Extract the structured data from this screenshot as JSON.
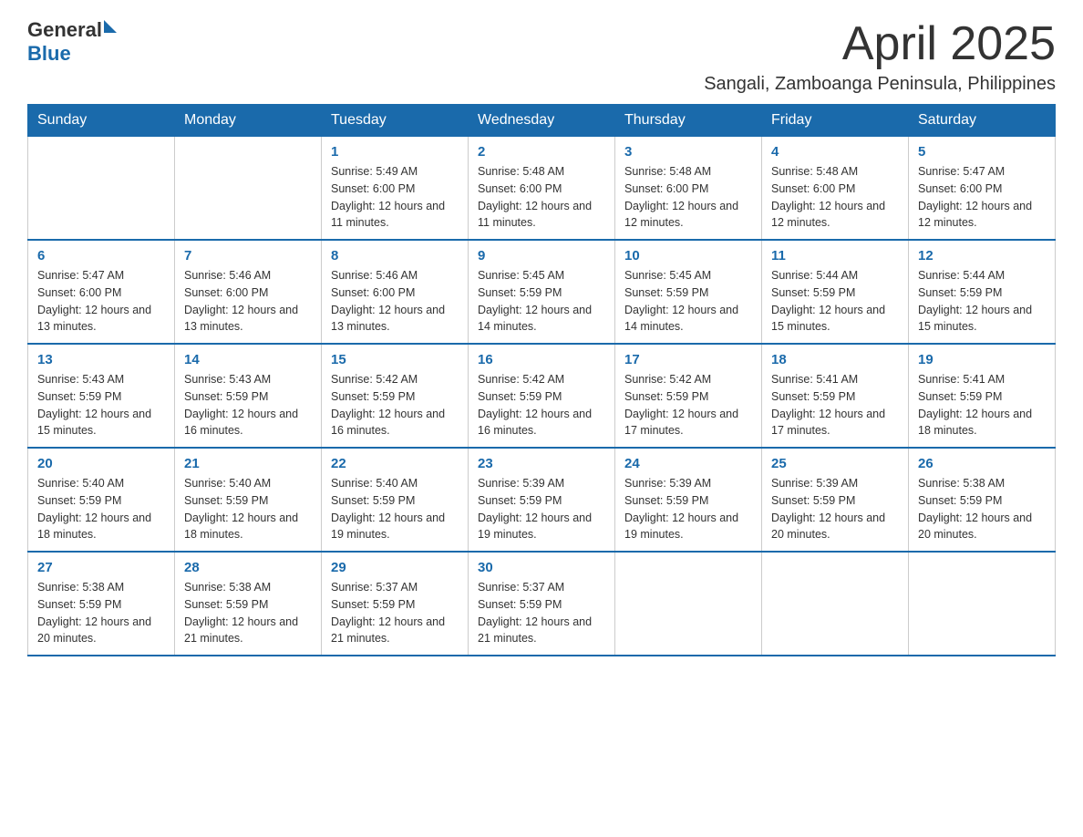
{
  "logo": {
    "general": "General",
    "blue": "Blue"
  },
  "title": {
    "month_year": "April 2025",
    "location": "Sangali, Zamboanga Peninsula, Philippines"
  },
  "weekdays": [
    "Sunday",
    "Monday",
    "Tuesday",
    "Wednesday",
    "Thursday",
    "Friday",
    "Saturday"
  ],
  "weeks": [
    [
      {
        "day": "",
        "sunrise": "",
        "sunset": "",
        "daylight": ""
      },
      {
        "day": "",
        "sunrise": "",
        "sunset": "",
        "daylight": ""
      },
      {
        "day": "1",
        "sunrise": "Sunrise: 5:49 AM",
        "sunset": "Sunset: 6:00 PM",
        "daylight": "Daylight: 12 hours and 11 minutes."
      },
      {
        "day": "2",
        "sunrise": "Sunrise: 5:48 AM",
        "sunset": "Sunset: 6:00 PM",
        "daylight": "Daylight: 12 hours and 11 minutes."
      },
      {
        "day": "3",
        "sunrise": "Sunrise: 5:48 AM",
        "sunset": "Sunset: 6:00 PM",
        "daylight": "Daylight: 12 hours and 12 minutes."
      },
      {
        "day": "4",
        "sunrise": "Sunrise: 5:48 AM",
        "sunset": "Sunset: 6:00 PM",
        "daylight": "Daylight: 12 hours and 12 minutes."
      },
      {
        "day": "5",
        "sunrise": "Sunrise: 5:47 AM",
        "sunset": "Sunset: 6:00 PM",
        "daylight": "Daylight: 12 hours and 12 minutes."
      }
    ],
    [
      {
        "day": "6",
        "sunrise": "Sunrise: 5:47 AM",
        "sunset": "Sunset: 6:00 PM",
        "daylight": "Daylight: 12 hours and 13 minutes."
      },
      {
        "day": "7",
        "sunrise": "Sunrise: 5:46 AM",
        "sunset": "Sunset: 6:00 PM",
        "daylight": "Daylight: 12 hours and 13 minutes."
      },
      {
        "day": "8",
        "sunrise": "Sunrise: 5:46 AM",
        "sunset": "Sunset: 6:00 PM",
        "daylight": "Daylight: 12 hours and 13 minutes."
      },
      {
        "day": "9",
        "sunrise": "Sunrise: 5:45 AM",
        "sunset": "Sunset: 5:59 PM",
        "daylight": "Daylight: 12 hours and 14 minutes."
      },
      {
        "day": "10",
        "sunrise": "Sunrise: 5:45 AM",
        "sunset": "Sunset: 5:59 PM",
        "daylight": "Daylight: 12 hours and 14 minutes."
      },
      {
        "day": "11",
        "sunrise": "Sunrise: 5:44 AM",
        "sunset": "Sunset: 5:59 PM",
        "daylight": "Daylight: 12 hours and 15 minutes."
      },
      {
        "day": "12",
        "sunrise": "Sunrise: 5:44 AM",
        "sunset": "Sunset: 5:59 PM",
        "daylight": "Daylight: 12 hours and 15 minutes."
      }
    ],
    [
      {
        "day": "13",
        "sunrise": "Sunrise: 5:43 AM",
        "sunset": "Sunset: 5:59 PM",
        "daylight": "Daylight: 12 hours and 15 minutes."
      },
      {
        "day": "14",
        "sunrise": "Sunrise: 5:43 AM",
        "sunset": "Sunset: 5:59 PM",
        "daylight": "Daylight: 12 hours and 16 minutes."
      },
      {
        "day": "15",
        "sunrise": "Sunrise: 5:42 AM",
        "sunset": "Sunset: 5:59 PM",
        "daylight": "Daylight: 12 hours and 16 minutes."
      },
      {
        "day": "16",
        "sunrise": "Sunrise: 5:42 AM",
        "sunset": "Sunset: 5:59 PM",
        "daylight": "Daylight: 12 hours and 16 minutes."
      },
      {
        "day": "17",
        "sunrise": "Sunrise: 5:42 AM",
        "sunset": "Sunset: 5:59 PM",
        "daylight": "Daylight: 12 hours and 17 minutes."
      },
      {
        "day": "18",
        "sunrise": "Sunrise: 5:41 AM",
        "sunset": "Sunset: 5:59 PM",
        "daylight": "Daylight: 12 hours and 17 minutes."
      },
      {
        "day": "19",
        "sunrise": "Sunrise: 5:41 AM",
        "sunset": "Sunset: 5:59 PM",
        "daylight": "Daylight: 12 hours and 18 minutes."
      }
    ],
    [
      {
        "day": "20",
        "sunrise": "Sunrise: 5:40 AM",
        "sunset": "Sunset: 5:59 PM",
        "daylight": "Daylight: 12 hours and 18 minutes."
      },
      {
        "day": "21",
        "sunrise": "Sunrise: 5:40 AM",
        "sunset": "Sunset: 5:59 PM",
        "daylight": "Daylight: 12 hours and 18 minutes."
      },
      {
        "day": "22",
        "sunrise": "Sunrise: 5:40 AM",
        "sunset": "Sunset: 5:59 PM",
        "daylight": "Daylight: 12 hours and 19 minutes."
      },
      {
        "day": "23",
        "sunrise": "Sunrise: 5:39 AM",
        "sunset": "Sunset: 5:59 PM",
        "daylight": "Daylight: 12 hours and 19 minutes."
      },
      {
        "day": "24",
        "sunrise": "Sunrise: 5:39 AM",
        "sunset": "Sunset: 5:59 PM",
        "daylight": "Daylight: 12 hours and 19 minutes."
      },
      {
        "day": "25",
        "sunrise": "Sunrise: 5:39 AM",
        "sunset": "Sunset: 5:59 PM",
        "daylight": "Daylight: 12 hours and 20 minutes."
      },
      {
        "day": "26",
        "sunrise": "Sunrise: 5:38 AM",
        "sunset": "Sunset: 5:59 PM",
        "daylight": "Daylight: 12 hours and 20 minutes."
      }
    ],
    [
      {
        "day": "27",
        "sunrise": "Sunrise: 5:38 AM",
        "sunset": "Sunset: 5:59 PM",
        "daylight": "Daylight: 12 hours and 20 minutes."
      },
      {
        "day": "28",
        "sunrise": "Sunrise: 5:38 AM",
        "sunset": "Sunset: 5:59 PM",
        "daylight": "Daylight: 12 hours and 21 minutes."
      },
      {
        "day": "29",
        "sunrise": "Sunrise: 5:37 AM",
        "sunset": "Sunset: 5:59 PM",
        "daylight": "Daylight: 12 hours and 21 minutes."
      },
      {
        "day": "30",
        "sunrise": "Sunrise: 5:37 AM",
        "sunset": "Sunset: 5:59 PM",
        "daylight": "Daylight: 12 hours and 21 minutes."
      },
      {
        "day": "",
        "sunrise": "",
        "sunset": "",
        "daylight": ""
      },
      {
        "day": "",
        "sunrise": "",
        "sunset": "",
        "daylight": ""
      },
      {
        "day": "",
        "sunrise": "",
        "sunset": "",
        "daylight": ""
      }
    ]
  ]
}
